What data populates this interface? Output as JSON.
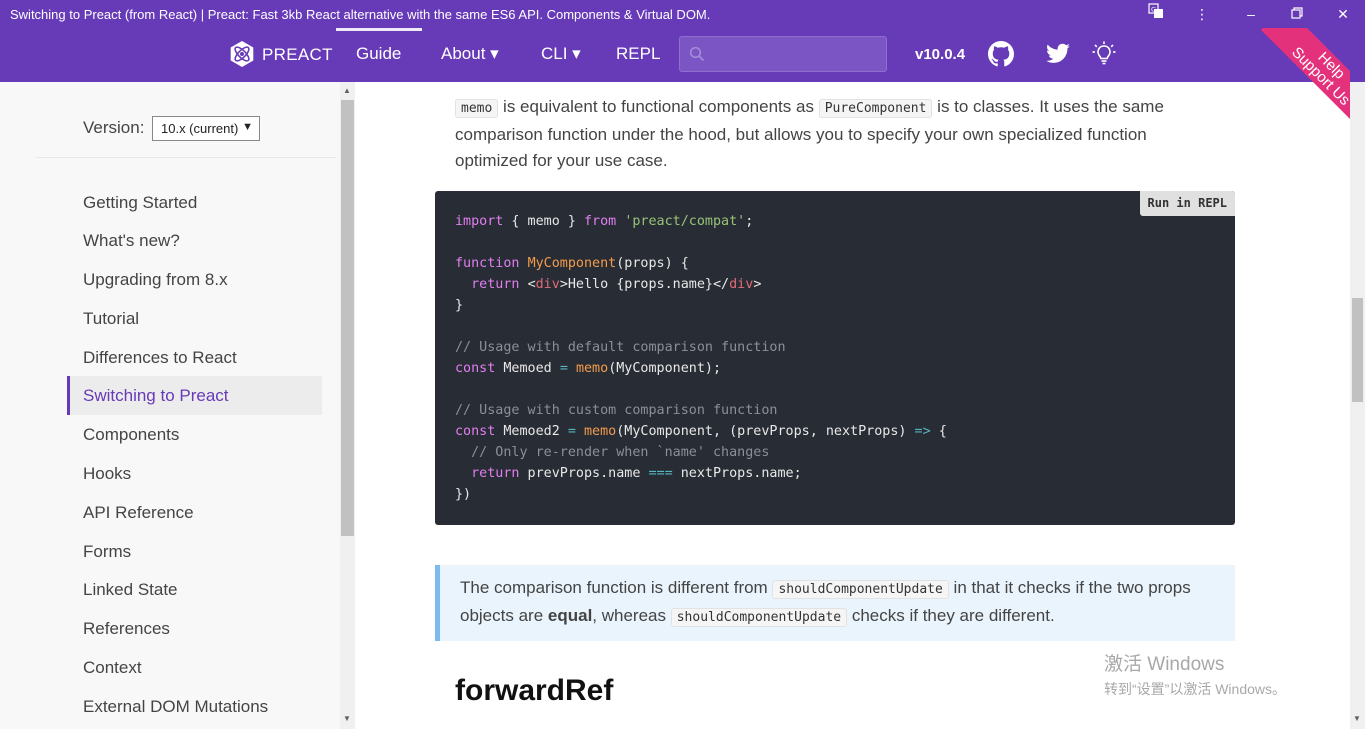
{
  "window": {
    "title": "Switching to Preact (from React) | Preact: Fast 3kb React alternative with the same ES6 API. Components & Virtual DOM."
  },
  "nav": {
    "brand": "PREACT",
    "links": [
      {
        "label": "Guide"
      },
      {
        "label": "About ▾"
      },
      {
        "label": "CLI ▾"
      },
      {
        "label": "REPL"
      }
    ],
    "search_value": "",
    "version": "v10.0.4",
    "accent": "#673ab8"
  },
  "ribbon": {
    "line1": "Help",
    "line2": "Support Us"
  },
  "sidebar": {
    "version_label": "Version:",
    "version_selected": "10.x (current)",
    "items": [
      {
        "label": "Getting Started"
      },
      {
        "label": "What's new?"
      },
      {
        "label": "Upgrading from 8.x"
      },
      {
        "label": "Tutorial"
      },
      {
        "label": "Differences to React"
      },
      {
        "label": "Switching to Preact"
      },
      {
        "label": "Components"
      },
      {
        "label": "Hooks"
      },
      {
        "label": "API Reference"
      },
      {
        "label": "Forms"
      },
      {
        "label": "Linked State"
      },
      {
        "label": "References"
      },
      {
        "label": "Context"
      },
      {
        "label": "External DOM Mutations"
      }
    ]
  },
  "content": {
    "p1": {
      "code1": "memo",
      "t1": " is equivalent to functional components as ",
      "code2": "PureComponent",
      "t2": " is to classes. It uses the same comparison function under the hood, but allows you to specify your own specialized function optimized for your use case."
    },
    "repl_button": "Run in REPL",
    "code": {
      "l1_import": "import",
      "l1_braces": " { memo } ",
      "l1_from": "from",
      "l1_str": "'preact/compat'",
      "l1_end": ";",
      "l3_function": "function",
      "l3_name": "MyComponent",
      "l3_rest": "(props) {",
      "l4_return": "return",
      "l4_lt": "<",
      "l4_tag": "div",
      "l4_mid": ">Hello {props.name}</",
      "l4_tag2": "div",
      "l4_gt": ">",
      "l5": "}",
      "l7_comment": "// Usage with default comparison function",
      "l8_const": "const",
      "l8_var": " Memoed ",
      "l8_eq": "=",
      "l8_fn": "memo",
      "l8_rest": "(MyComponent);",
      "l10_comment": "// Usage with custom comparison function",
      "l11_const": "const",
      "l11_var": " Memoed2 ",
      "l11_eq": "=",
      "l11_fn": "memo",
      "l11_rest": "(MyComponent, (prevProps, nextProps) ",
      "l11_arrow": "=>",
      "l11_end": " {",
      "l12_comment": "// Only re-render when `name' changes",
      "l13_return": "return",
      "l13_a": " prevProps.name ",
      "l13_op": "===",
      "l13_b": " nextProps.name;",
      "l14": "})"
    },
    "note": {
      "t1": "The comparison function is different from ",
      "code1": "shouldComponentUpdate",
      "t2": " in that it checks if the two props objects are ",
      "bold": "equal",
      "t3": ", whereas ",
      "code2": "shouldComponentUpdate",
      "t4": " checks if they are different."
    },
    "heading": "forwardRef"
  },
  "watermark": {
    "line1": "激活 Windows",
    "line2": "转到“设置”以激活 Windows。"
  }
}
